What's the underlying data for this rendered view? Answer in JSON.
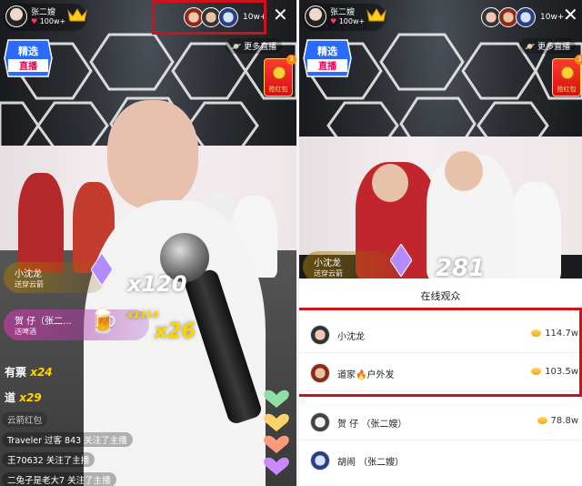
{
  "left": {
    "host": {
      "name": "张二嫂",
      "likes": "100w+"
    },
    "viewers": {
      "count": "10w+"
    },
    "badge": {
      "line1": "精选",
      "line2": "直播"
    },
    "more_live": "更多直播",
    "redpack": {
      "label": "抢红包",
      "count": "3"
    },
    "gifts": [
      {
        "name": "小沈龙",
        "sub": "送穿云箭",
        "mult": "x120"
      },
      {
        "name": "贺 仔（张二...",
        "sub": "送啤酒",
        "mult": "x26",
        "small_mult": "x1314"
      }
    ],
    "combo_lines": [
      {
        "text": "有票",
        "mult": "x24"
      },
      {
        "text": "道",
        "mult": "x29"
      }
    ],
    "chat": [
      "云箭红包",
      "Traveler 过客 843 关注了主播",
      "王70632 关注了主播",
      "二兔子是老大7 关注了主播"
    ]
  },
  "right": {
    "host": {
      "name": "张二嫂",
      "likes": "100w+"
    },
    "viewers": {
      "count": "10w+"
    },
    "badge": {
      "line1": "精选",
      "line2": "直播"
    },
    "more_live": "更多直播",
    "redpack": {
      "label": "抢红包",
      "count": "3"
    },
    "gift": {
      "name": "小沈龙",
      "sub": "送穿云箭",
      "mult": "281"
    },
    "sheet_title": "在线观众",
    "audience": [
      {
        "name": "小沈龙",
        "score": "114.7w"
      },
      {
        "name": "道家🔥户外发",
        "score": "103.5w"
      },
      {
        "name": "贺 仔 （张二嫂）",
        "score": "78.8w"
      },
      {
        "name": "胡闹 （张二嫂）",
        "score": ""
      }
    ]
  },
  "colors": {
    "highlight": "#d0111b",
    "gold": "#ffd400"
  }
}
